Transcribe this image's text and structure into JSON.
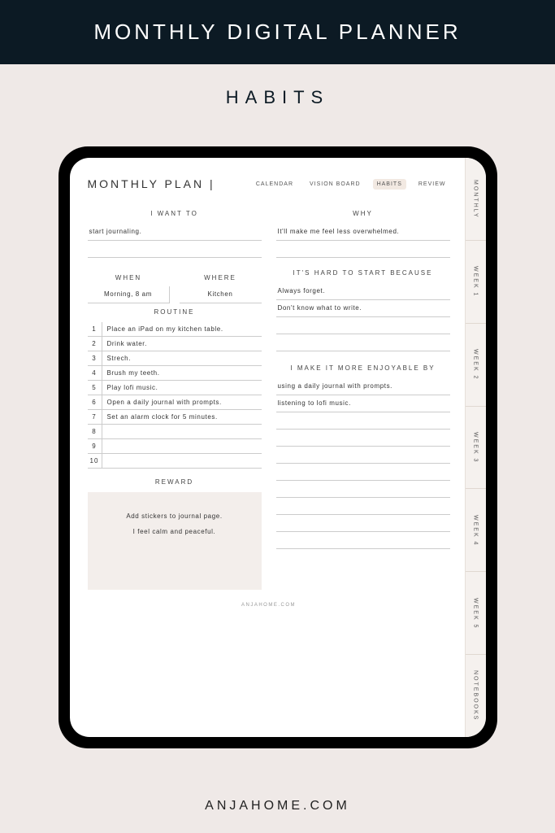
{
  "header": {
    "title": "MONTHLY DIGITAL PLANNER",
    "subtitle": "HABITS"
  },
  "brand": "ANJAHOME.COM",
  "planner": {
    "title": "MONTHLY PLAN |",
    "nav_tabs": [
      "CALENDAR",
      "VISION BOARD",
      "HABITS",
      "REVIEW"
    ],
    "active_tab_index": 2,
    "side_tabs": [
      "MONTHLY",
      "WEEK 1",
      "WEEK 2",
      "WEEK 3",
      "WEEK 4",
      "WEEK 5",
      "NOTEBOOKS"
    ],
    "sections": {
      "i_want_to": {
        "heading": "I WANT TO",
        "value": "start journaling."
      },
      "why": {
        "heading": "WHY",
        "value": "It'll make me feel less overwhelmed."
      },
      "when": {
        "heading": "WHEN",
        "value": "Morning, 8 am"
      },
      "where": {
        "heading": "WHERE",
        "value": "Kitchen"
      },
      "hard_because": {
        "heading": "IT'S HARD TO START BECAUSE",
        "lines": [
          "Always forget.",
          "Don't know what to write.",
          "",
          ""
        ]
      },
      "routine": {
        "heading": "ROUTINE",
        "items": [
          "Place an iPad on my kitchen table.",
          "Drink water.",
          "Strech.",
          "Brush my teeth.",
          "Play lofi music.",
          "Open a daily journal with prompts.",
          "Set an alarm clock for 5 minutes.",
          "",
          "",
          ""
        ]
      },
      "enjoyable": {
        "heading": "I MAKE IT MORE ENJOYABLE BY",
        "lines": [
          "using a daily journal with prompts.",
          "listening to lofi music.",
          "",
          "",
          "",
          "",
          "",
          "",
          "",
          ""
        ]
      },
      "reward": {
        "heading": "REWARD",
        "lines": [
          "Add stickers to journal page.",
          "I feel calm and peaceful."
        ]
      }
    },
    "footer": "ANJAHOME.COM"
  }
}
